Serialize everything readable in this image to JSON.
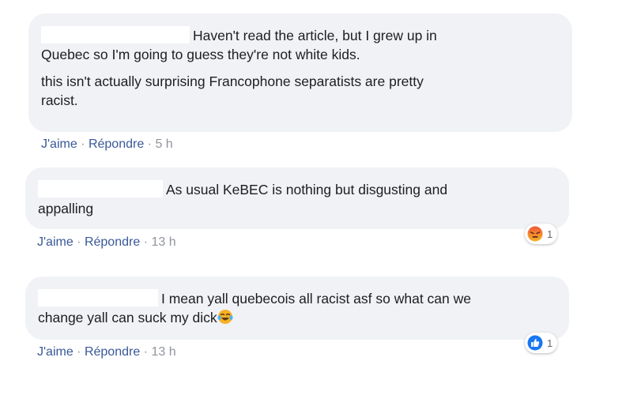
{
  "comments": [
    {
      "lines": [
        "Haven't read the article, but I grew up in",
        "Quebec so I'm going to guess they're not white kids."
      ],
      "extra": [
        "this isn't actually surprising Francophone separatists are pretty",
        "racist."
      ],
      "actions": {
        "like": "J'aime",
        "reply": "Répondre",
        "time": "5 h"
      }
    },
    {
      "lines": [
        "As usual KeBEC is nothing but disgusting and",
        "appalling"
      ],
      "actions": {
        "like": "J'aime",
        "reply": "Répondre",
        "time": "13 h"
      },
      "reaction": {
        "icon": "angry-face-icon",
        "count": "1"
      }
    },
    {
      "lines": [
        "I mean yall quebecois all racist asf so what can we",
        "change yall can suck my dick"
      ],
      "inline_emoji": "laughing-crying-face-icon",
      "actions": {
        "like": "J'aime",
        "reply": "Répondre",
        "time": "13 h"
      },
      "reaction": {
        "icon": "like-thumb-icon",
        "count": "1"
      }
    }
  ],
  "colors": {
    "bubble": "#f0f2f5",
    "link": "#385898",
    "like_blue": "#1877f2",
    "angry": "#f0583b"
  }
}
